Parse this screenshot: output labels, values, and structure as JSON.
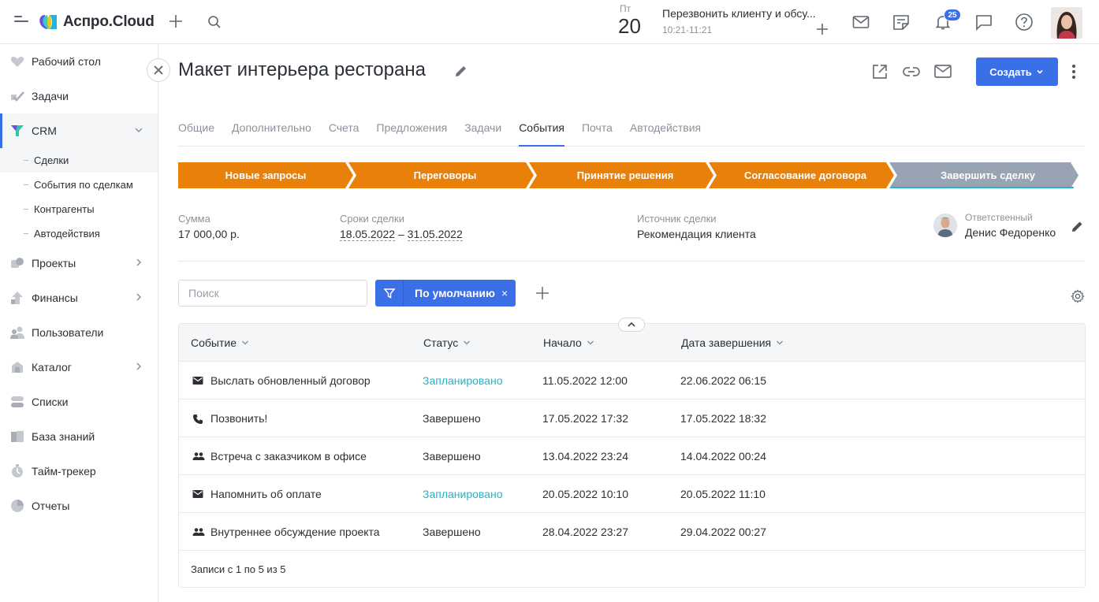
{
  "app": {
    "logo_text": "Аспро.Cloud"
  },
  "topbar": {
    "day_name": "Пт",
    "day_number": "20",
    "event_title": "Перезвонить клиенту и обсу...",
    "event_time": "10:21-11:21",
    "notifications_count": "25"
  },
  "sidebar": {
    "items": [
      {
        "label": "Рабочий стол",
        "icon": "heart-icon"
      },
      {
        "label": "Задачи",
        "icon": "check-icon"
      },
      {
        "label": "CRM",
        "icon": "crm-icon"
      },
      {
        "label": "Проекты",
        "icon": "projects-icon"
      },
      {
        "label": "Финансы",
        "icon": "finance-icon"
      },
      {
        "label": "Пользователи",
        "icon": "users-icon"
      },
      {
        "label": "Каталог",
        "icon": "catalog-icon"
      },
      {
        "label": "Списки",
        "icon": "lists-icon"
      },
      {
        "label": "База знаний",
        "icon": "knowledge-icon"
      },
      {
        "label": "Тайм-трекер",
        "icon": "timer-icon"
      },
      {
        "label": "Отчеты",
        "icon": "reports-icon"
      }
    ],
    "crm_sub": [
      {
        "label": "Сделки"
      },
      {
        "label": "События по сделкам"
      },
      {
        "label": "Контрагенты"
      },
      {
        "label": "Автодействия"
      }
    ]
  },
  "deal": {
    "title": "Макет интерьера ресторана",
    "create_label": "Создать"
  },
  "tabs": [
    "Общие",
    "Дополнительно",
    "Счета",
    "Предложения",
    "Задачи",
    "События",
    "Почта",
    "Автодействия"
  ],
  "stages": [
    {
      "label": "Новые запросы",
      "color": "#e8800a"
    },
    {
      "label": "Переговоры",
      "color": "#e8800a"
    },
    {
      "label": "Принятие решения",
      "color": "#e8800a"
    },
    {
      "label": "Согласование договора",
      "color": "#e8800a"
    },
    {
      "label": "Завершить сделку",
      "color": "#98a3b3"
    }
  ],
  "info": {
    "sum_label": "Сумма",
    "sum_value": "17 000,00 р.",
    "dates_label": "Сроки сделки",
    "date_start": "18.05.2022",
    "date_sep": "–",
    "date_end": "31.05.2022",
    "source_label": "Источник сделки",
    "source_value": "Рекомендация клиента",
    "responsible_label": "Ответственный",
    "responsible_value": "Денис Федоренко"
  },
  "filters": {
    "search_placeholder": "Поиск",
    "preset_label": "По умолчанию",
    "clear_glyph": "×"
  },
  "table": {
    "columns": [
      "Событие",
      "Статус",
      "Начало",
      "Дата завершения"
    ],
    "rows": [
      {
        "icon": "mail-icon",
        "event": "Выслать обновленный договор",
        "status": "Запланировано",
        "planned": true,
        "start": "11.05.2022 12:00",
        "end": "22.06.2022 06:15"
      },
      {
        "icon": "phone-icon",
        "event": "Позвонить!",
        "status": "Завершено",
        "planned": false,
        "start": "17.05.2022 17:32",
        "end": "17.05.2022 18:32"
      },
      {
        "icon": "meeting-icon",
        "event": "Встреча с заказчиком в офисе",
        "status": "Завершено",
        "planned": false,
        "start": "13.04.2022 23:24",
        "end": "14.04.2022 00:24"
      },
      {
        "icon": "mail-icon",
        "event": "Напомнить об оплате",
        "status": "Запланировано",
        "planned": true,
        "start": "20.05.2022 10:10",
        "end": "20.05.2022 11:10"
      },
      {
        "icon": "meeting-icon",
        "event": "Внутреннее обсуждение проекта",
        "status": "Завершено",
        "planned": false,
        "start": "28.04.2022 23:27",
        "end": "29.04.2022 00:27"
      }
    ],
    "footer": "Записи с 1 по 5 из 5"
  },
  "colors": {
    "accent": "#3b6fe8",
    "stage_active": "#e8800a",
    "stage_next": "#98a3b3",
    "status_planned": "#26b5c4"
  }
}
